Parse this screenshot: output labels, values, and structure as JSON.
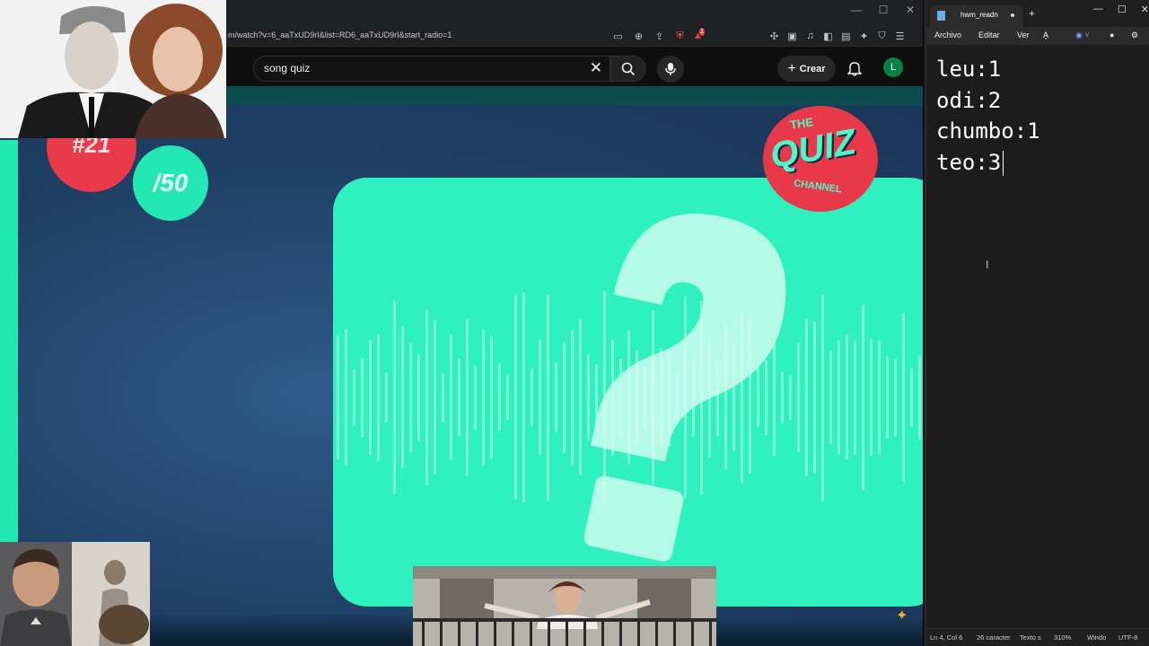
{
  "browser": {
    "url": "m/watch?v=6_aaTxUD9rI&list=RD6_aaTxUD9rI&start_radio=1",
    "extension_badge": "1"
  },
  "youtube": {
    "search_value": "song quiz",
    "create_label": "Crear",
    "avatar_letter": "L"
  },
  "video": {
    "question_number": "#21",
    "question_total": "/50",
    "logo_top": "THE",
    "logo_main": "QUIZ",
    "logo_bottom": "CHANNEL",
    "colors": {
      "teal": "#2ff0bf",
      "red": "#e83a4a",
      "navy": "#234a72"
    }
  },
  "notepad": {
    "tab_title": "hwm_readn",
    "menu": {
      "file": "Archivo",
      "edit": "Editar",
      "view": "Ver"
    },
    "lines": [
      "leu:1",
      "odi:2",
      "chumbo:1",
      "teo:3"
    ],
    "status": {
      "position": "Ln 4, Col 6",
      "chars": "26 caracter",
      "format": "Texto s",
      "zoom": "310%",
      "line_ending": "Windo",
      "encoding": "UTF-8"
    }
  }
}
